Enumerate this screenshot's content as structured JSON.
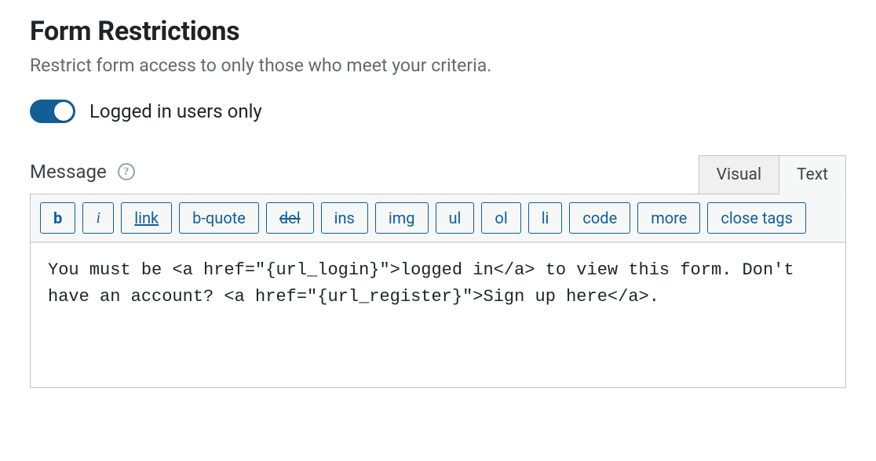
{
  "header": {
    "title": "Form Restrictions",
    "subtitle": "Restrict form access to only those who meet your criteria."
  },
  "toggle": {
    "label": "Logged in users only",
    "on": true
  },
  "message": {
    "label": "Message",
    "help_glyph": "?"
  },
  "tabs": {
    "visual": "Visual",
    "text": "Text",
    "active": "text"
  },
  "quicktags": {
    "b": "b",
    "i": "i",
    "link": "link",
    "bquote": "b-quote",
    "del": "del",
    "ins": "ins",
    "img": "img",
    "ul": "ul",
    "ol": "ol",
    "li": "li",
    "code": "code",
    "more": "more",
    "close": "close tags"
  },
  "editor": {
    "content": "You must be <a href=\"{url_login}\">logged in</a> to view this form. Don't have an account? <a href=\"{url_register}\">Sign up here</a>."
  }
}
